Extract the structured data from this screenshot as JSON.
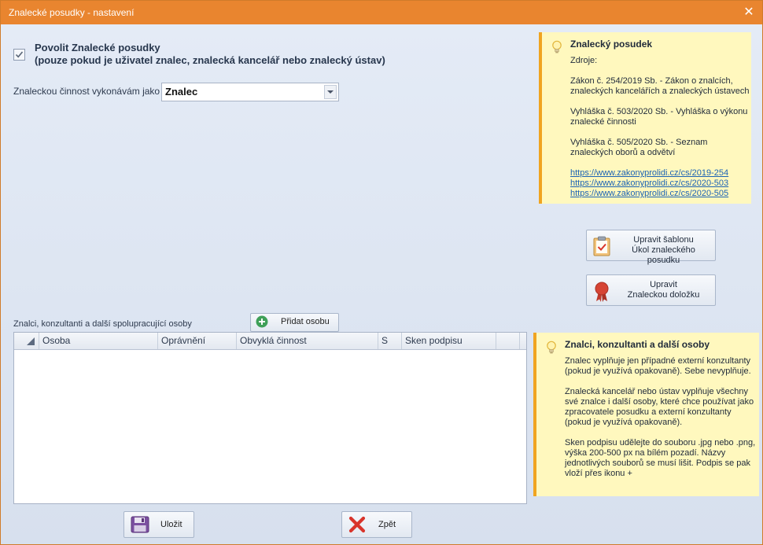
{
  "window": {
    "title": "Znalecké posudky - nastavení"
  },
  "enable": {
    "checked": true,
    "line1": "Povolit Znalecké posudky",
    "line2": "(pouze pokud je uživatel znalec, znalecká kancelář nebo znalecký ústav)"
  },
  "role": {
    "label": "Znaleckou činnost vykonávám jako",
    "value": "Znalec"
  },
  "info_law": {
    "title": "Znalecký posudek",
    "sources_label": "Zdroje:",
    "laws": [
      "Zákon č. 254/2019 Sb. - Zákon o znalcích, znaleckých kancelářích a znaleckých ústavech",
      "Vyhláška č. 503/2020 Sb. - Vyhláška o výkonu znalecké činnosti",
      "Vyhláška č. 505/2020 Sb. - Seznam znaleckých oborů a odvětví"
    ],
    "links": [
      "https://www.zakonyprolidi.cz/cs/2019-254",
      "https://www.zakonyprolidi.cz/cs/2020-503",
      "https://www.zakonyprolidi.cz/cs/2020-505"
    ]
  },
  "buttons": {
    "edit_template_line1": "Upravit šablonu",
    "edit_template_line2": "Úkol znaleckého posudku",
    "edit_clause_line1": "Upravit",
    "edit_clause_line2": "Znaleckou doložku",
    "add_person": "Přidat osobu",
    "save": "Uložit",
    "back": "Zpět"
  },
  "people": {
    "label": "Znalci, konzultanti a další spolupracující osoby",
    "columns": [
      "Osoba",
      "Oprávnění",
      "Obvyklá činnost",
      "S",
      "Sken podpisu"
    ]
  },
  "info_people": {
    "title": "Znalci, konzultanti a další osoby",
    "paragraphs": [
      "Znalec vyplňuje jen případné externí konzultanty (pokud je využívá opakovaně). Sebe nevyplňuje.",
      "Znalecká kancelář nebo ústav vyplňuje všechny své znalce i další osoby, které chce používat jako zpracovatele posudku a externí konzultanty (pokud je využívá opakovaně).",
      "Sken podpisu udělejte do souboru .jpg nebo .png, výška 200-500 px na bílém pozadí. Názvy jednotlivých souborů se musí lišit. Podpis se pak vloží přes ikonu +"
    ]
  },
  "colors": {
    "titlebar": "#e9852f",
    "info_border": "#f0a420",
    "info_bg": "#fff8be"
  }
}
